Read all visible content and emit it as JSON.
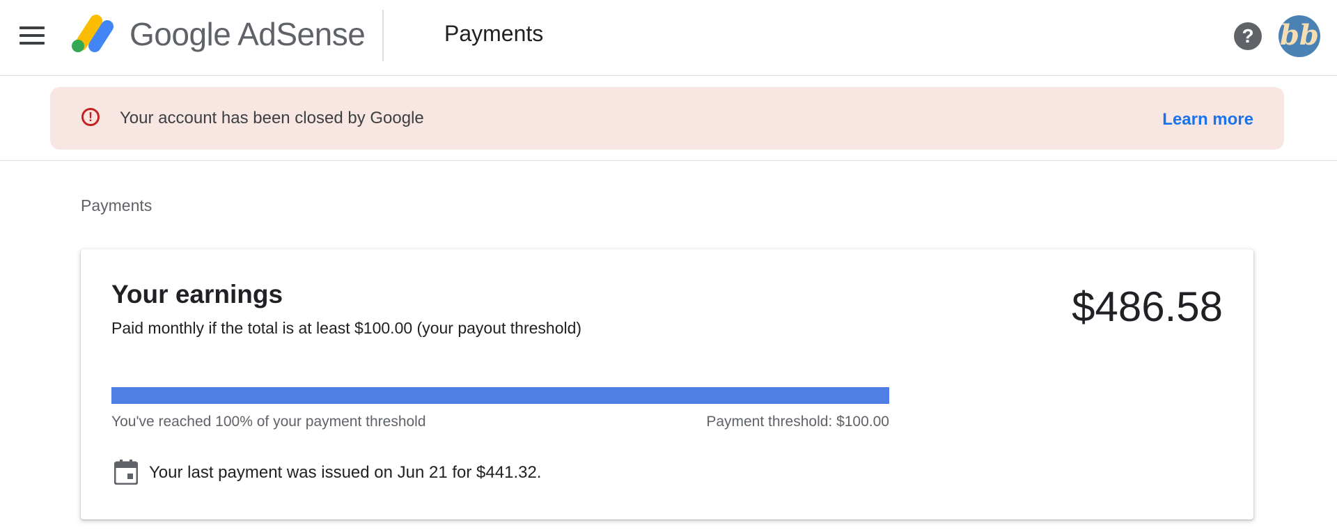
{
  "header": {
    "brand_google": "Google",
    "brand_product": "AdSense",
    "page_title": "Payments",
    "help_symbol": "?",
    "avatar_initials": "bb",
    "menu_icon": "hamburger-menu-icon",
    "help_icon": "help-circle-icon"
  },
  "banner": {
    "icon": "alert-circle-icon",
    "icon_symbol": "!",
    "message": "Your account has been closed by Google",
    "action_label": "Learn more",
    "background_color": "#f8e6e2",
    "icon_color": "#c5221f",
    "action_color": "#1a73e8"
  },
  "breadcrumb": "Payments",
  "earnings": {
    "title": "Your earnings",
    "subtitle": "Paid monthly if the total is at least $100.00 (your payout threshold)",
    "amount": "$486.58",
    "progress_percent": 100,
    "progress_color": "#4f7fe5",
    "progress_left_text": "You've reached 100% of your payment threshold",
    "progress_right_text": "Payment threshold: $100.00",
    "last_payment_icon": "calendar-icon",
    "last_payment_text": "Your last payment was issued on Jun 21 for $441.32."
  }
}
